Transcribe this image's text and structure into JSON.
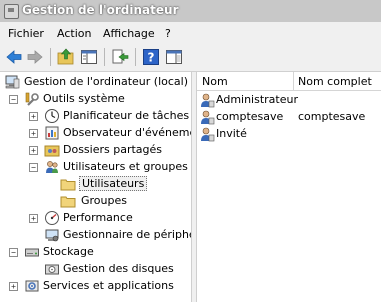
{
  "window": {
    "title": "Gestion de l'ordinateur"
  },
  "menu": {
    "items": [
      "Fichier",
      "Action",
      "Affichage",
      "?"
    ]
  },
  "toolbar": {
    "buttons": [
      "back-icon",
      "forward-icon",
      "up-folder-icon",
      "show-hide-tree-icon",
      "export-list-icon",
      "help-icon",
      "properties-pane-icon"
    ]
  },
  "tree": {
    "root": "Gestion de l'ordinateur (local)",
    "outils": "Outils système",
    "planificateur": "Planificateur de tâches",
    "observateur": "Observateur d'événements",
    "dossiers": "Dossiers partagés",
    "utilisateurs_groupes": "Utilisateurs et groupes locaux",
    "utilisateurs": "Utilisateurs",
    "groupes": "Groupes",
    "performance": "Performance",
    "gestionnaire": "Gestionnaire de périphériques",
    "stockage": "Stockage",
    "gestion_disques": "Gestion des disques",
    "services": "Services et applications",
    "expand_plus": "+",
    "expand_minus": "−"
  },
  "list": {
    "columns": [
      "Nom",
      "Nom complet"
    ],
    "rows": [
      {
        "name": "Administrateur",
        "full": ""
      },
      {
        "name": "comptesave",
        "full": "comptesave"
      },
      {
        "name": "Invité",
        "full": ""
      }
    ]
  }
}
